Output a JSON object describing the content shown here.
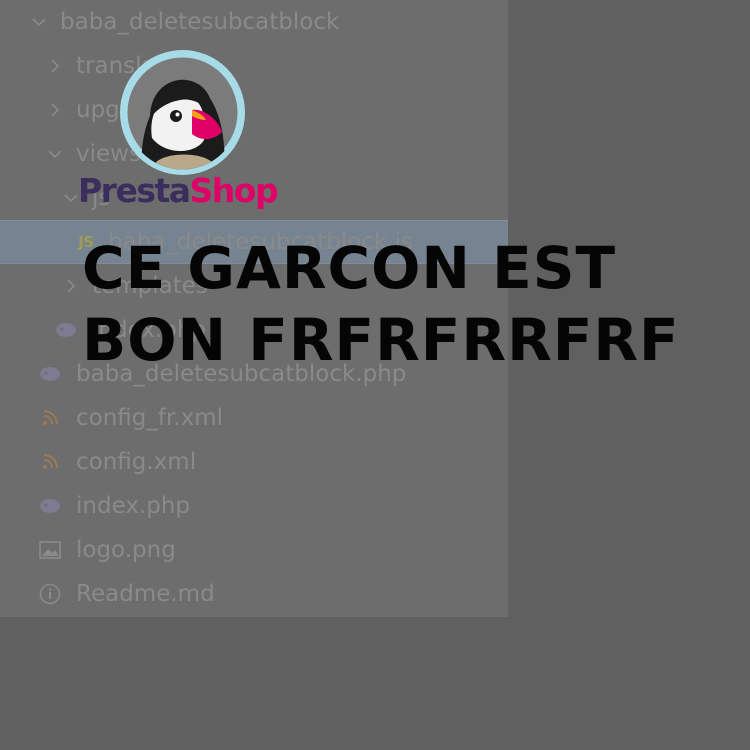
{
  "file_tree": {
    "items": [
      {
        "label": "baba_deletesubcatblock",
        "kind": "folder",
        "expanded": true,
        "icon": "chevron-down-icon"
      },
      {
        "label": "translations",
        "kind": "folder",
        "expanded": false,
        "icon": "chevron-right-icon"
      },
      {
        "label": "upgrade",
        "kind": "folder",
        "expanded": false,
        "icon": "chevron-right-icon"
      },
      {
        "label": "views",
        "kind": "folder",
        "expanded": true,
        "icon": "chevron-down-icon"
      },
      {
        "label": "js",
        "kind": "folder",
        "expanded": true,
        "icon": "chevron-down-icon"
      },
      {
        "label": "baba_deletesubcatblock.js",
        "kind": "file",
        "icon": "js-file-icon",
        "badge": "JS",
        "selected": true
      },
      {
        "label": "templates",
        "kind": "folder",
        "expanded": false,
        "icon": "chevron-right-icon"
      },
      {
        "label": "index.php",
        "kind": "file",
        "icon": "php-file-icon"
      },
      {
        "label": "baba_deletesubcatblock.php",
        "kind": "file",
        "icon": "php-file-icon"
      },
      {
        "label": "config_fr.xml",
        "kind": "file",
        "icon": "xml-file-icon"
      },
      {
        "label": "config.xml",
        "kind": "file",
        "icon": "xml-file-icon"
      },
      {
        "label": "index.php",
        "kind": "file",
        "icon": "php-file-icon"
      },
      {
        "label": "logo.png",
        "kind": "file",
        "icon": "image-file-icon"
      },
      {
        "label": "Readme.md",
        "kind": "file",
        "icon": "info-file-icon"
      }
    ]
  },
  "logo": {
    "text_part1": "Presta",
    "text_part2": "Shop",
    "color_part1": "#3b2d5e",
    "color_part2": "#df0067",
    "mark": "puffin-mascot"
  },
  "headline": {
    "line1": "CE GARCON EST",
    "line2": "BON FRFRFRRFRF"
  },
  "colors": {
    "background": "#606060",
    "panel": "#6d6d6d",
    "selected_row": "#768390",
    "text": "#8a8a8a"
  }
}
